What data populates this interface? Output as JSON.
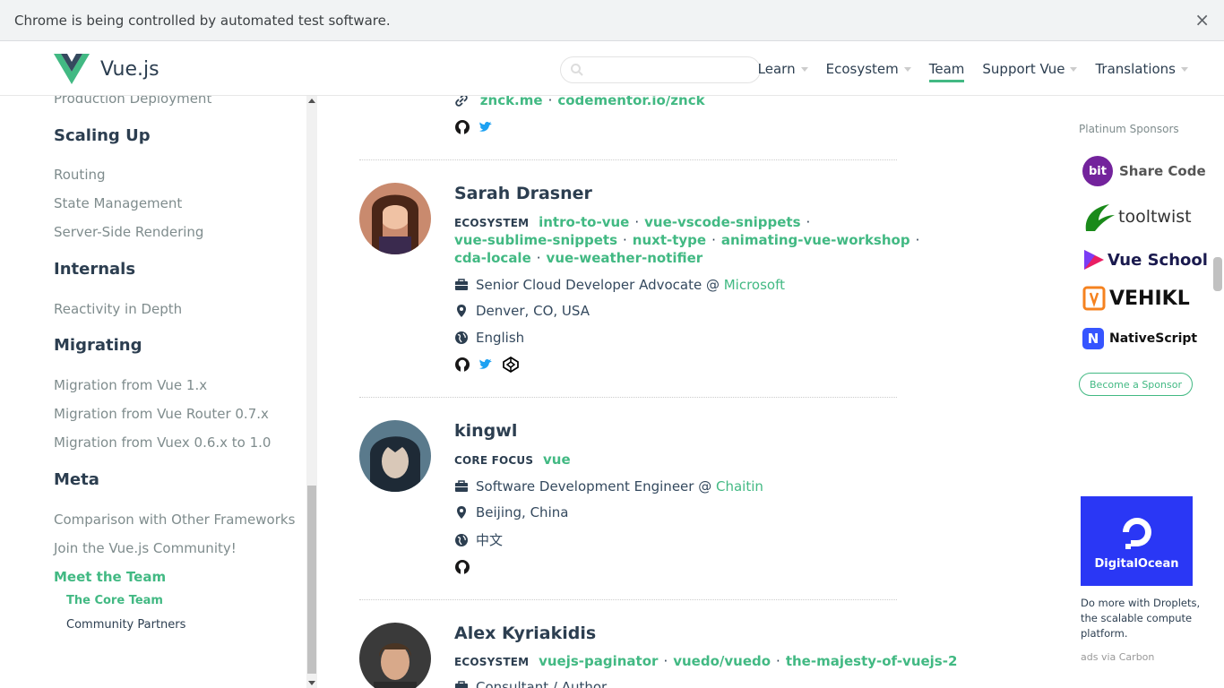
{
  "infobar": {
    "message": "Chrome is being controlled by automated test software.",
    "close": "×"
  },
  "header": {
    "logo_text": "Vue.js",
    "search_placeholder": "",
    "nav": [
      {
        "label": "Learn",
        "dropdown": true
      },
      {
        "label": "Ecosystem",
        "dropdown": true
      },
      {
        "label": "Team",
        "dropdown": false,
        "active": true
      },
      {
        "label": "Support Vue",
        "dropdown": true
      },
      {
        "label": "Translations",
        "dropdown": true
      }
    ]
  },
  "sidebar": {
    "cut_item": "Production Deployment",
    "sections": [
      {
        "heading": "Scaling Up",
        "items": [
          "Routing",
          "State Management",
          "Server-Side Rendering"
        ]
      },
      {
        "heading": "Internals",
        "items": [
          "Reactivity in Depth"
        ]
      },
      {
        "heading": "Migrating",
        "items": [
          "Migration from Vue 1.x",
          "Migration from Vue Router 0.7.x",
          "Migration from Vuex 0.6.x to 1.0"
        ]
      },
      {
        "heading": "Meta",
        "items": [
          "Comparison with Other Frameworks",
          "Join the Vue.js Community!",
          "Meet the Team"
        ]
      }
    ],
    "sub_items": [
      "The Core Team",
      "Community Partners"
    ]
  },
  "members": {
    "top": {
      "links": [
        "znck.me",
        "codementor.io/znck"
      ]
    },
    "sarah": {
      "name": "Sarah Drasner",
      "tag": "ECOSYSTEM",
      "projects": [
        "intro-to-vue",
        "vue-vscode-snippets",
        "vue-sublime-snippets",
        "nuxt-type",
        "animating-vue-workshop",
        "cda-locale",
        "vue-weather-notifier"
      ],
      "work": "Senior Cloud Developer Advocate @ ",
      "company": "Microsoft",
      "location": "Denver, CO, USA",
      "language": "English"
    },
    "kingwl": {
      "name": "kingwl",
      "tag": "CORE FOCUS",
      "projects": [
        "vue"
      ],
      "work": "Software Development Engineer @ ",
      "company": "Chaitin",
      "location": "Beijing, China",
      "language": "中文"
    },
    "alex": {
      "name": "Alex Kyriakidis",
      "tag": "ECOSYSTEM",
      "projects": [
        "vuejs-paginator",
        "vuedo/vuedo",
        "the-majesty-of-vuejs-2"
      ],
      "work": "Consultant / Author"
    }
  },
  "ads": {
    "platinum_label": "Platinum Sponsors",
    "sponsors": [
      {
        "badge": "bit",
        "name": "Share Code"
      },
      {
        "name": "tooltwist"
      },
      {
        "name": "Vue School"
      },
      {
        "name": "VEHIKL"
      },
      {
        "badge": "N",
        "name": "NativeScript"
      }
    ],
    "become_sponsor": "Become a Sponsor",
    "carbon_brand": "DigitalOcean",
    "carbon_text": "Do more with Droplets, the scalable compute platform.",
    "carbon_via": "ads via Carbon"
  },
  "colors": {
    "accent": "#42b983",
    "text": "#2c3e50"
  }
}
